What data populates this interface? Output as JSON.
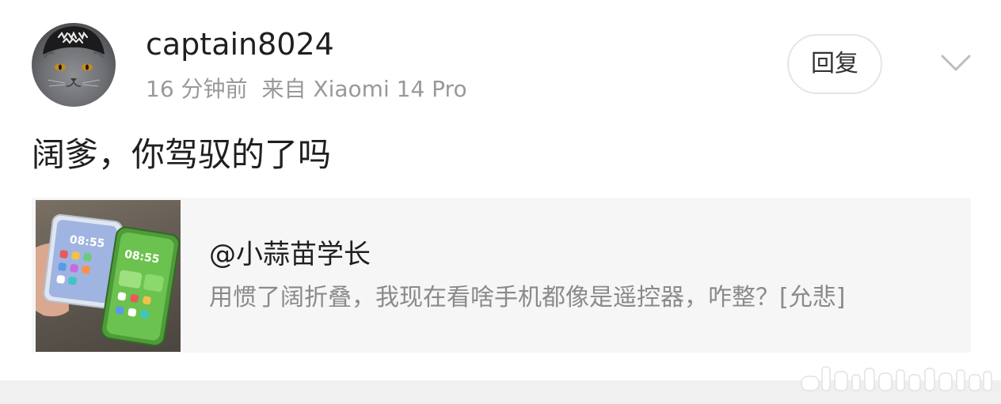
{
  "post": {
    "username": "captain8024",
    "time_ago": "16 分钟前",
    "source": "来自 Xiaomi 14 Pro",
    "reply_label": "回复",
    "comment_text": "阔爹，你驾驭的了吗"
  },
  "repost": {
    "author": "@小蒜苗学长",
    "text": "用惯了阔折叠，我现在看啥手机都像是遥控器，咋整？[允悲]",
    "thumbnail": {
      "left_phone_time": "08:55",
      "right_phone_time": "08:55"
    }
  },
  "icons": {
    "avatar": "cat-avatar-icon",
    "expand": "chevron-down-icon"
  },
  "colors": {
    "text_primary": "#1f1f1f",
    "text_secondary": "#999999",
    "repost_background": "#f6f6f6",
    "reply_border": "#e5e5e5"
  }
}
